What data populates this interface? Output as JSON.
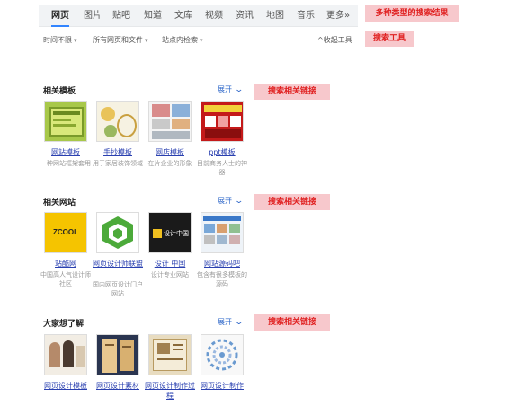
{
  "tabs": [
    {
      "label": "网页",
      "active": true
    },
    {
      "label": "图片"
    },
    {
      "label": "贴吧"
    },
    {
      "label": "知道"
    },
    {
      "label": "文库"
    },
    {
      "label": "视频"
    },
    {
      "label": "资讯"
    },
    {
      "label": "地图"
    },
    {
      "label": "音乐"
    },
    {
      "label": "更多»"
    }
  ],
  "annotations": {
    "multi_results": "多种类型的搜索结果",
    "search_tools": "搜索工具",
    "related_links": "搜索相关链接"
  },
  "filters": {
    "time": "时间不限",
    "filetype": "所有网页和文件",
    "site": "站点内检索",
    "collapse": "^收起工具"
  },
  "sections": [
    {
      "title": "相关模板",
      "expand": "展开",
      "items": [
        {
          "name": "网站模板",
          "desc": "一种网站框架套用"
        },
        {
          "name": "手抄模板",
          "desc": "用于家居装饰领域"
        },
        {
          "name": "网店模板",
          "desc": "在片企业的形象"
        },
        {
          "name": "ppt模板",
          "desc": "目前商务人士的神器"
        }
      ]
    },
    {
      "title": "相关网站",
      "expand": "展开",
      "items": [
        {
          "name": "站酷网",
          "desc": "中国高人气设计师社区"
        },
        {
          "name": "网页设计师联盟",
          "desc": "国内网页设计门户网站"
        },
        {
          "name": "设计 中国",
          "desc": "设计专业网站"
        },
        {
          "name": "网站源码吧",
          "desc": "包含有很多模板的源码"
        }
      ]
    },
    {
      "title": "大家想了解",
      "expand": "展开",
      "items": [
        {
          "name": "网页设计模板",
          "desc": ""
        },
        {
          "name": "网页设计素材",
          "desc": ""
        },
        {
          "name": "网页设计制作过程",
          "desc": ""
        },
        {
          "name": "网页设计制作",
          "desc": ""
        }
      ]
    }
  ],
  "thumb_text": {
    "zcool": "ZCOOL",
    "sheji": "设计中国"
  },
  "colors": {
    "accent": "#3385ff",
    "link": "#2a40b0",
    "tag_bg": "#f7c8cc",
    "tag_text": "#e02020"
  }
}
